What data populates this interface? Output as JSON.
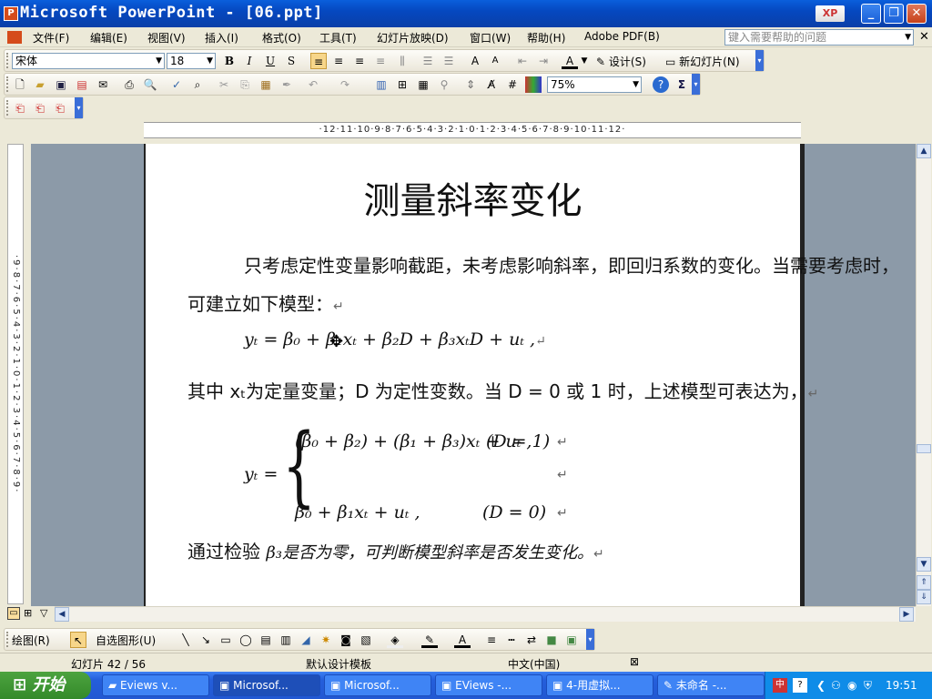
{
  "window": {
    "title": "Microsoft PowerPoint - [06.ppt]",
    "minimize_glyph": "_",
    "maximize_glyph": "❐",
    "close_glyph": "✕"
  },
  "menu": {
    "items": [
      "文件(F)",
      "编辑(E)",
      "视图(V)",
      "插入(I)",
      "格式(O)",
      "工具(T)",
      "幻灯片放映(D)",
      "窗口(W)",
      "帮助(H)",
      "Adobe PDF(B)"
    ],
    "help_placeholder": "键入需要帮助的问题"
  },
  "format_toolbar": {
    "font_name": "宋体",
    "font_size": "18",
    "design_label": "设计(S)",
    "new_slide_label": "新幻灯片(N)"
  },
  "standard_toolbar": {
    "zoom": "75%"
  },
  "ruler": {
    "horizontal": "·12·11·10·9·8·7·6·5·4·3·2·1·0·1·2·3·4·5·6·7·8·9·10·11·12·",
    "vertical": "·9·8·7·6·5·4·3·2·1·0·1·2·3·4·5·6·7·8·9·"
  },
  "slide": {
    "title": "测量斜率变化",
    "para1_line1": "只考虑定性变量影响截距，未考虑影响斜率，即回归系数的变化。当需要考虑时，",
    "para1_line2": "可建立如下模型：",
    "equation1": "yₜ = β₀ + β₁xₜ + β₂D + β₃xₜD + uₜ ,",
    "para2": "其中 xₜ为定量变量；D 为定性变数。当 D = 0 或 1 时，上述模型可表达为，",
    "piecewise_lhs": "yₜ =",
    "case1": "(β₀ + β₂) + (β₁ + β₃)xₜ + uₜ ,",
    "case1_cond": "(D = 1)",
    "case2": "β₀ + β₁xₜ + uₜ ,",
    "case2_cond": "(D = 0)",
    "para3_a": "通过检验",
    "para3_b": "β₃是否为零，可判断模型斜率是否发生变化。",
    "para_mark": "↵"
  },
  "drawing_toolbar": {
    "draw_label": "绘图(R)",
    "autoshapes_label": "自选图形(U)"
  },
  "status": {
    "slide_pos": "幻灯片 42 / 56",
    "template": "默认设计模板",
    "language": "中文(中国)"
  },
  "taskbar": {
    "start": "开始",
    "tasks": [
      "Eviews v...",
      "Microsof...",
      "Microsof...",
      "EViews -...",
      "4-用虚拟...",
      "未命名 -..."
    ],
    "clock": "19:51"
  },
  "colors": {
    "titlebar": "#0a52d0",
    "workspace": "#8c9aa8",
    "taskbar": "#245edb",
    "start": "#3c9a33"
  }
}
